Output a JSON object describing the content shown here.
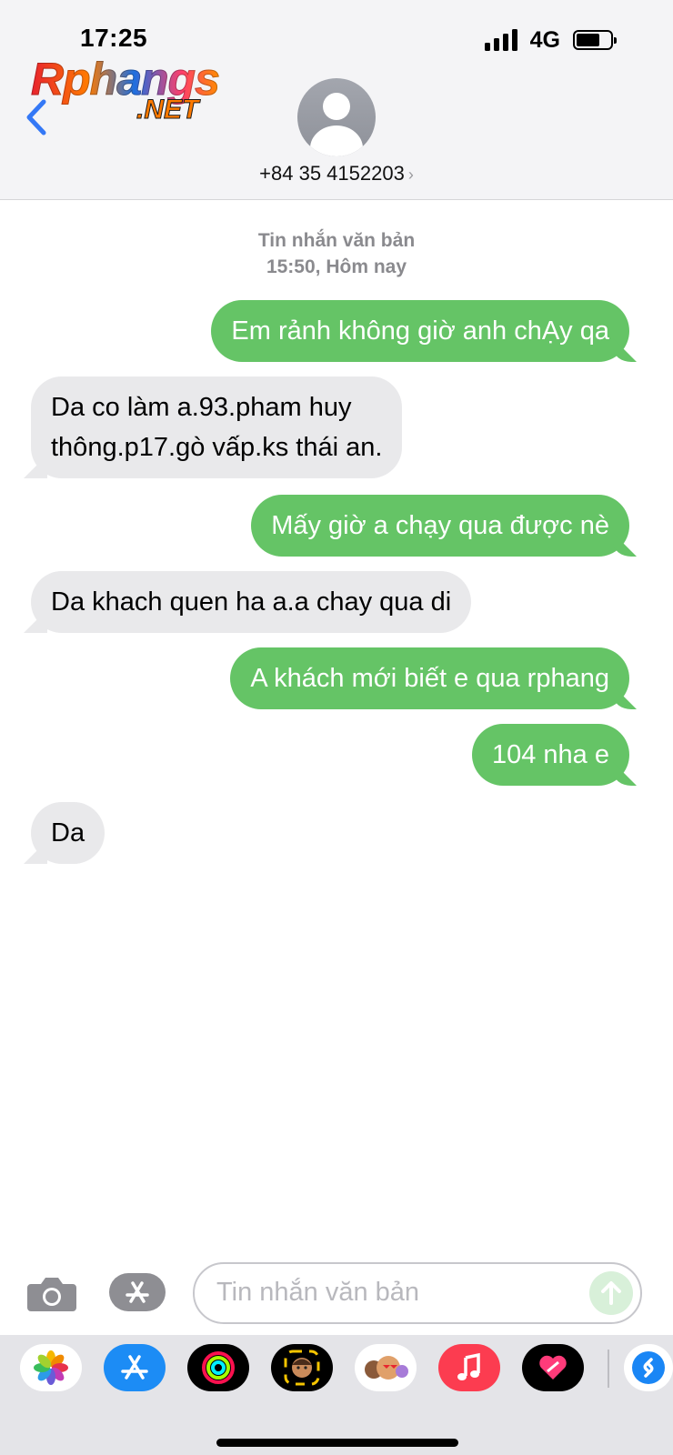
{
  "status_bar": {
    "time": "17:25",
    "network": "4G",
    "battery_level": 0.7
  },
  "logo": {
    "main": "Rphangs",
    "sub": ".NET"
  },
  "header": {
    "contact": "+84 35 4152203",
    "contact_chevron": "›"
  },
  "conversation": {
    "service_label": "Tin nhắn văn bản",
    "timestamp": "15:50, Hôm nay",
    "messages": [
      {
        "direction": "out",
        "text": "Em rảnh không giờ anh chẠy qa"
      },
      {
        "direction": "in",
        "lines": [
          "Da co làm a.93.pham huy",
          "thông.p17.gò vấp.ks thái an."
        ]
      },
      {
        "direction": "out",
        "text": "Mấy giờ a chạy qua được nè"
      },
      {
        "direction": "in",
        "text": "Da khach quen ha a.a chay qua di"
      },
      {
        "direction": "out",
        "text": "A khách mới biết e qua rphang"
      },
      {
        "direction": "out",
        "text": "104 nha e"
      },
      {
        "direction": "in",
        "text": "Da"
      }
    ]
  },
  "composer": {
    "placeholder": "Tin nhắn văn bản"
  },
  "app_drawer": {
    "apps": [
      "photos-icon",
      "app-store-icon",
      "fitness-icon",
      "memoji-icon",
      "animoji-icon",
      "music-icon",
      "heart-app-icon",
      "shazam-icon"
    ]
  },
  "colors": {
    "outgoing_bubble": "#65c466",
    "incoming_bubble": "#e9e9eb",
    "accent_blue": "#3478f6"
  }
}
